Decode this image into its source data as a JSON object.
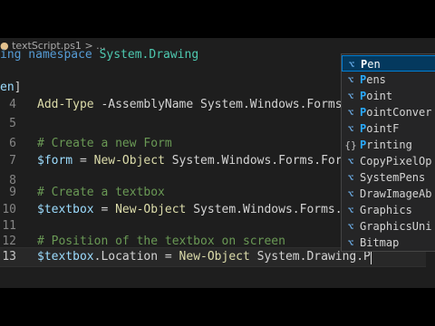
{
  "tab": {
    "file_name": "textScript.ps1",
    "separator": ">",
    "ellipsis": "..."
  },
  "lines": [
    {
      "num": "",
      "parts": [
        [
          "kw",
          "ing namespace "
        ],
        [
          "ty",
          "System.Drawing"
        ]
      ]
    },
    {
      "num": "",
      "parts": [
        [
          "var",
          "en"
        ],
        [
          "plain",
          "]"
        ]
      ]
    },
    {
      "num": "4",
      "parts": [
        [
          "fn",
          "Add-Type"
        ],
        [
          "plain",
          " -AssemblyName System.Windows.Forms"
        ]
      ]
    },
    {
      "num": "5",
      "parts": []
    },
    {
      "num": "6",
      "parts": [
        [
          "cmt",
          "# Create a new Form"
        ]
      ]
    },
    {
      "num": "7",
      "parts": [
        [
          "var",
          "$form"
        ],
        [
          "plain",
          " = "
        ],
        [
          "fn",
          "New-Object"
        ],
        [
          "plain",
          " System.Windows.Forms.Form"
        ]
      ]
    },
    {
      "num": "8",
      "parts": []
    },
    {
      "num": "9",
      "parts": [
        [
          "cmt",
          "# Create a textbox"
        ]
      ]
    },
    {
      "num": "10",
      "parts": [
        [
          "var",
          "$textbox"
        ],
        [
          "plain",
          " = "
        ],
        [
          "fn",
          "New-Object"
        ],
        [
          "plain",
          " System.Windows.Forms.Text"
        ]
      ]
    },
    {
      "num": "11",
      "parts": []
    },
    {
      "num": "12",
      "parts": [
        [
          "cmt",
          "# Position of the textbox on screen"
        ]
      ]
    },
    {
      "num": "13",
      "parts": [
        [
          "var",
          "$textbox"
        ],
        [
          "plain",
          ".Location = "
        ],
        [
          "fn",
          "New-Object"
        ],
        [
          "plain",
          " System.Drawing.P"
        ]
      ]
    }
  ],
  "suggestions": [
    {
      "icon": "class-icon",
      "glyph": "⌥",
      "hl": "P",
      "rest": "en",
      "selected": true
    },
    {
      "icon": "class-icon",
      "glyph": "⌥",
      "hl": "P",
      "rest": "ens",
      "selected": false
    },
    {
      "icon": "class-icon",
      "glyph": "⌥",
      "hl": "P",
      "rest": "oint",
      "selected": false
    },
    {
      "icon": "class-icon",
      "glyph": "⌥",
      "hl": "P",
      "rest": "ointConver",
      "selected": false
    },
    {
      "icon": "class-icon",
      "glyph": "⌥",
      "hl": "P",
      "rest": "ointF",
      "selected": false
    },
    {
      "icon": "namespace-icon",
      "glyph": "{}",
      "hl": "P",
      "rest": "rinting",
      "selected": false
    },
    {
      "icon": "class-icon",
      "glyph": "⌥",
      "hl": "",
      "rest": "CopyPixelOp",
      "selected": false
    },
    {
      "icon": "class-icon",
      "glyph": "⌥",
      "hl": "",
      "rest": "SystemPens",
      "selected": false
    },
    {
      "icon": "class-icon",
      "glyph": "⌥",
      "hl": "",
      "rest": "DrawImageAb",
      "selected": false
    },
    {
      "icon": "class-icon",
      "glyph": "⌥",
      "hl": "",
      "rest": "Graphics",
      "selected": false
    },
    {
      "icon": "class-icon",
      "glyph": "⌥",
      "hl": "",
      "rest": "GraphicsUni",
      "selected": false
    },
    {
      "icon": "class-icon",
      "glyph": "⌥",
      "hl": "",
      "rest": "Bitmap",
      "selected": false
    }
  ],
  "colors": {
    "editor_bg": "#1e1e1e",
    "selection_bg": "#04395e",
    "selection_border": "#007fd4",
    "keyword": "#569cd6",
    "type": "#4ec9b0",
    "variable": "#9cdcfe",
    "comment": "#6a9955",
    "function": "#dcdcaa"
  }
}
